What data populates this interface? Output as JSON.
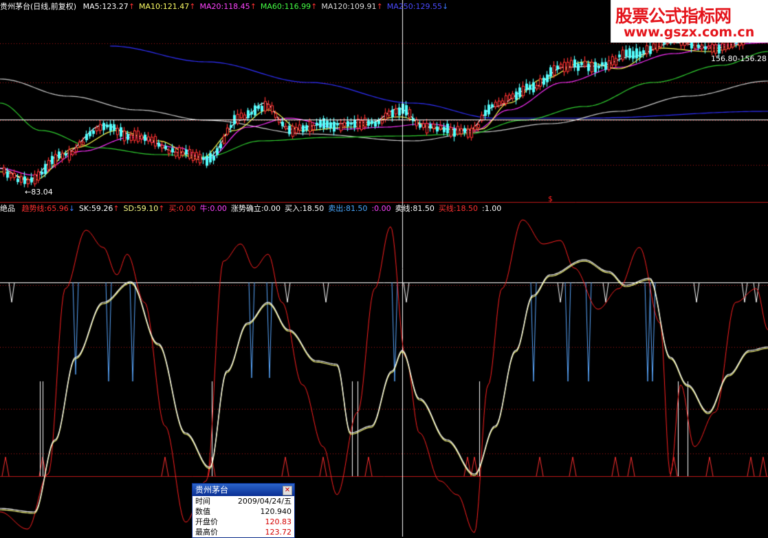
{
  "ma_row": {
    "stock": "贵州茅台(日线,前复权)",
    "items": [
      {
        "text": "MA5:123.27",
        "color": "#ffffff",
        "arrow": "↑",
        "arrow_color": "#ff3030"
      },
      {
        "text": "MA10:121.47",
        "color": "#ffff66",
        "arrow": "↑",
        "arrow_color": "#ff3030"
      },
      {
        "text": "MA20:118.45",
        "color": "#ff44ff",
        "arrow": "↑",
        "arrow_color": "#ff3030"
      },
      {
        "text": "MA60:116.99",
        "color": "#44ff44",
        "arrow": "↑",
        "arrow_color": "#ff3030"
      },
      {
        "text": "MA120:109.91",
        "color": "#dddddd",
        "arrow": "↑",
        "arrow_color": "#ff3030"
      },
      {
        "text": "MA250:129.55",
        "color": "#4a4aff",
        "arrow": "↓",
        "arrow_color": "#3a7bff"
      }
    ]
  },
  "ind_row": {
    "name": "绝品",
    "items": [
      {
        "text": "趋势线:65.96",
        "color": "#ff3030",
        "arrow": "↓",
        "arrow_color": "#3a7bff"
      },
      {
        "text": "SK:59.26",
        "color": "#ffffff",
        "arrow": "↑",
        "arrow_color": "#ff3030"
      },
      {
        "text": "SD:59.10",
        "color": "#ffff88",
        "arrow": "↑",
        "arrow_color": "#ff3030"
      },
      {
        "text": "买:0.00",
        "color": "#ff3030",
        "arrow": "",
        "arrow_color": ""
      },
      {
        "text": "牛:0.00",
        "color": "#ff44ff",
        "arrow": "",
        "arrow_color": ""
      },
      {
        "text": "涨势确立:0.00",
        "color": "#ffffff",
        "arrow": "",
        "arrow_color": ""
      },
      {
        "text": "买入:18.50",
        "color": "#ffffff",
        "arrow": "",
        "arrow_color": ""
      },
      {
        "text": "卖出:81.50",
        "color": "#4aa8ff",
        "arrow": "",
        "arrow_color": ""
      },
      {
        "text": ":0.00",
        "color": "#ff44ff",
        "arrow": "",
        "arrow_color": ""
      },
      {
        "text": "卖线:81.50",
        "color": "#ffffff",
        "arrow": "",
        "arrow_color": ""
      },
      {
        "text": "买线:18.50",
        "color": "#ff3030",
        "arrow": "",
        "arrow_color": ""
      },
      {
        "text": ":1.00",
        "color": "#ffffff",
        "arrow": "",
        "arrow_color": ""
      }
    ]
  },
  "annotations": {
    "low": "←83.04",
    "range": "156.80-156.28",
    "marker": "$"
  },
  "watermark": {
    "title": "股票公式指标网",
    "url": "www.gszx.com.cn"
  },
  "popup": {
    "title": "贵州茅台",
    "close": "✕",
    "rows": [
      {
        "label": "时间",
        "value": "2009/04/24/五",
        "red": false
      },
      {
        "label": "数值",
        "value": "120.940",
        "red": false
      },
      {
        "label": "开盘价",
        "value": "120.83",
        "red": true
      },
      {
        "label": "最高价",
        "value": "123.72",
        "red": true
      }
    ]
  },
  "colors": {
    "up": "#ff3232",
    "down": "#54ffff",
    "grid": "#b01818",
    "crosshair": "#ffffff"
  }
}
